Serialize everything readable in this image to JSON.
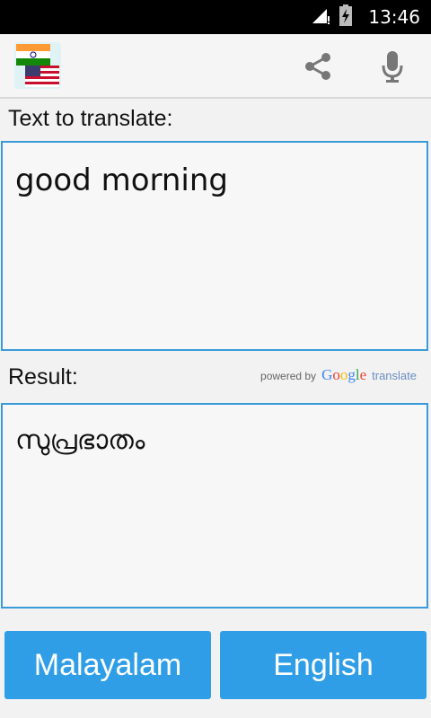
{
  "status_bar": {
    "time": "13:46"
  },
  "app_bar": {
    "icons": [
      "india-us-flags-icon",
      "share-icon",
      "microphone-icon"
    ]
  },
  "input_section": {
    "label": "Text to translate:",
    "value": "good morning"
  },
  "result_section": {
    "label": "Result:",
    "value": "സുപ്രഭാതം",
    "powered_by": {
      "prefix": "powered by",
      "brand": "Google",
      "suffix": "translate"
    }
  },
  "language_buttons": {
    "source": "Malayalam",
    "target": "English"
  },
  "colors": {
    "accent": "#2f9ee6",
    "border": "#3a9bd9"
  }
}
